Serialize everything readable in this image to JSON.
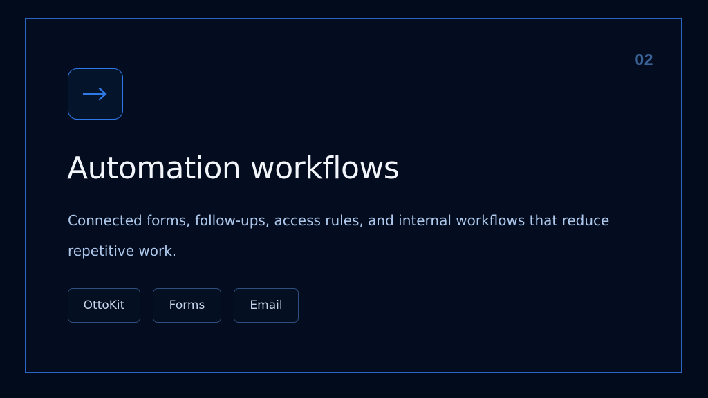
{
  "card": {
    "number": "02",
    "icon": "arrow-right-icon",
    "title": "Automation workflows",
    "description": "Connected forms, follow-ups, access rules, and internal workflows that reduce repetitive work.",
    "tags": [
      "OttoKit",
      "Forms",
      "Email"
    ]
  },
  "colors": {
    "background": "#020b1b",
    "border": "#2a66c4",
    "accent": "#2f79e6",
    "title": "#f2f5fa",
    "description": "#aec8ec",
    "number": "#3b6397"
  }
}
